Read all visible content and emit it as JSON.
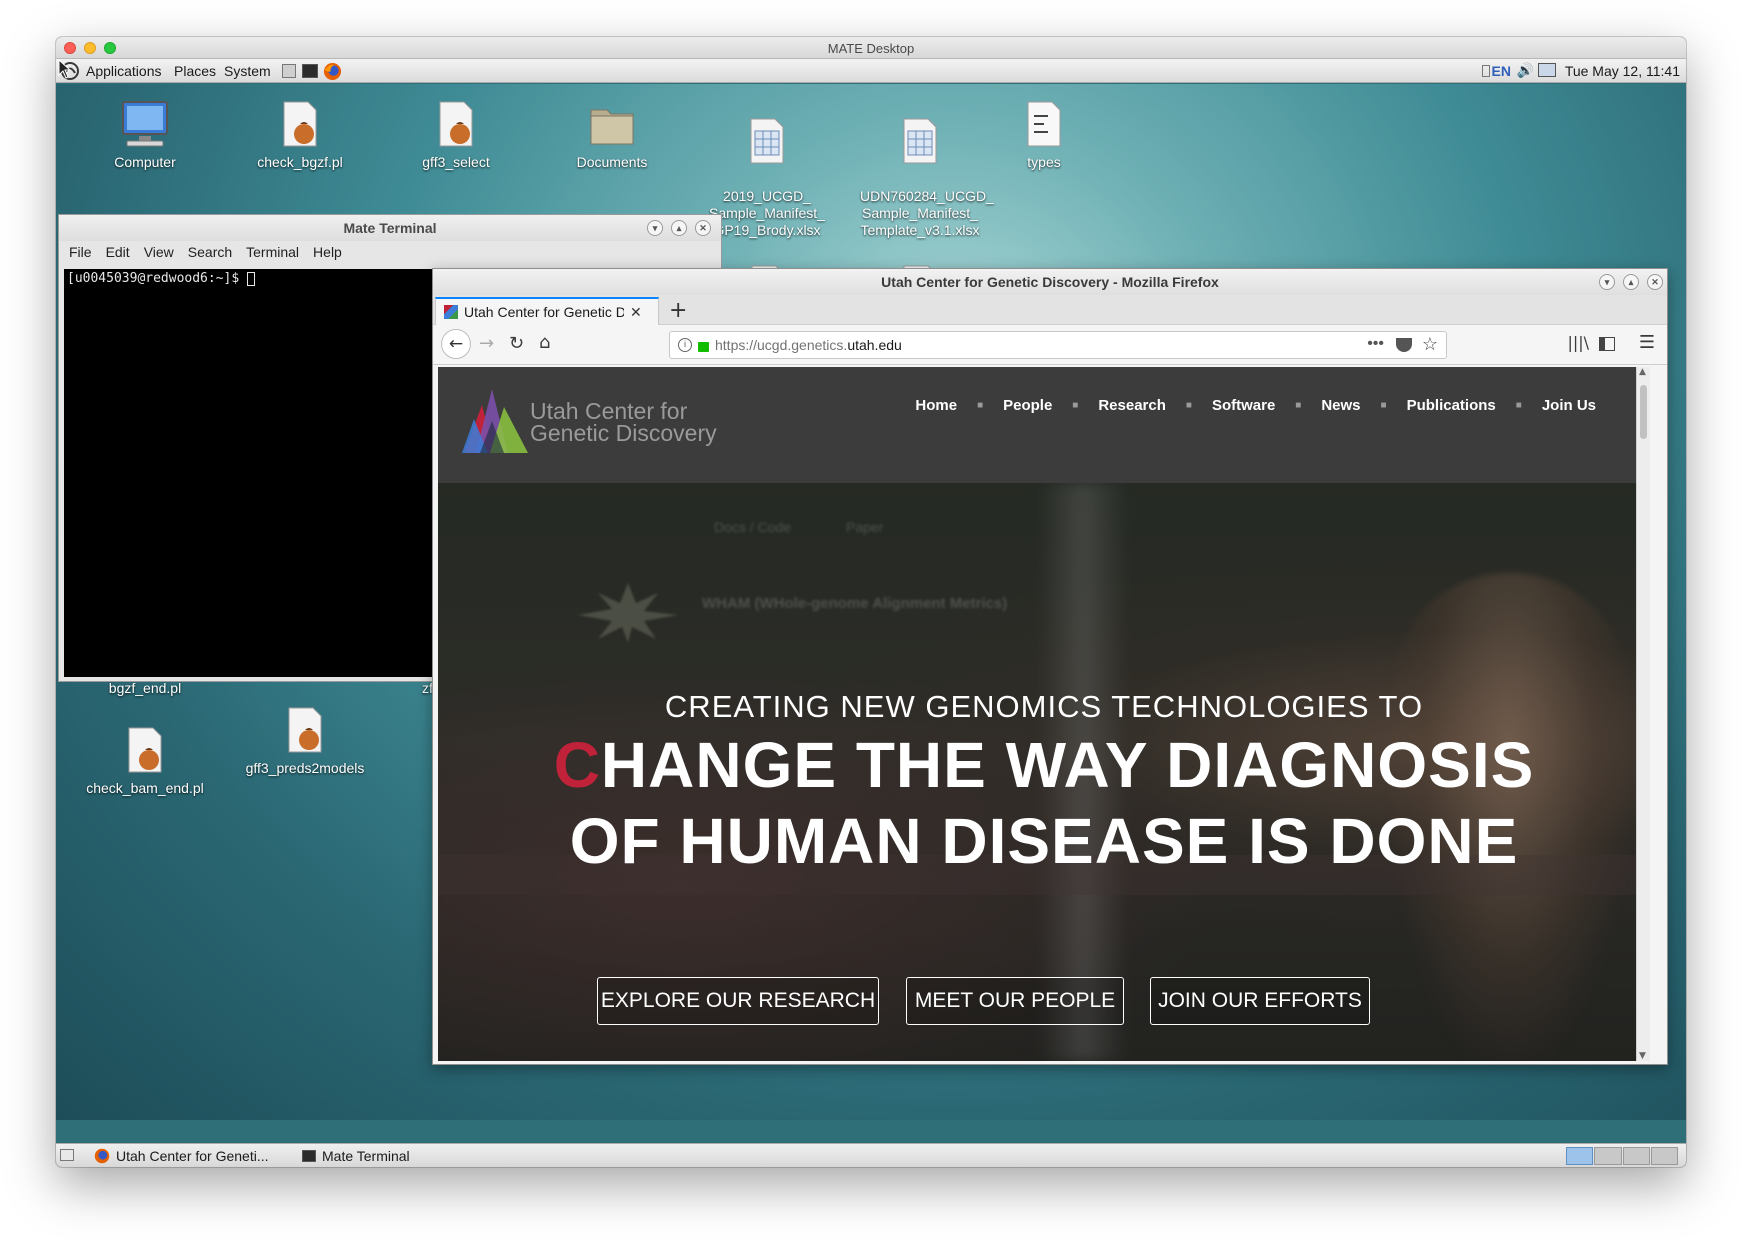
{
  "mac_window": {
    "title": "MATE Desktop"
  },
  "top_panel": {
    "menus": [
      "Applications",
      "Places",
      "System"
    ],
    "keyboard_layout": "EN",
    "clock": "Tue May 12, 11:41"
  },
  "desktop_icons": [
    {
      "label": "Computer"
    },
    {
      "label": "check_bgzf.pl"
    },
    {
      "label": "gff3_select"
    },
    {
      "label": "Documents"
    },
    {
      "label": "2019_UCGD_\nSample_Manifest_\nGP19_Brody.xlsx"
    },
    {
      "label": "UDN760284_UCGD_\nSample_Manifest_\nTemplate_v3.1.xlsx"
    },
    {
      "label": "types"
    },
    {
      "label": "bgzf_end.pl"
    },
    {
      "label": "zff2au"
    },
    {
      "label": "check_bam_end.pl"
    },
    {
      "label": "gff3_preds2models"
    }
  ],
  "terminal": {
    "title": "Mate Terminal",
    "menus": [
      "File",
      "Edit",
      "View",
      "Search",
      "Terminal",
      "Help"
    ],
    "prompt": "[u0045039@redwood6:~]$ "
  },
  "firefox": {
    "window_title": "Utah Center for Genetic Discovery - Mozilla Firefox",
    "tab_title": "Utah Center for Genetic D",
    "url_prefix": "https://ucgd.genetics.",
    "url_domain": "utah.edu",
    "url_suffix": ""
  },
  "site": {
    "logo_line1": "Utah Center for",
    "logo_line2": "Genetic Discovery",
    "nav": [
      "Home",
      "People",
      "Research",
      "Software",
      "News",
      "Publications",
      "Join Us"
    ],
    "hero_subtitle": "CREATING NEW GENOMICS TECHNOLOGIES TO",
    "hero_line1_first": "C",
    "hero_line1_rest": "HANGE THE WAY DIAGNOSIS",
    "hero_line2": "OF HUMAN DISEASE IS DONE",
    "buttons": [
      "EXPLORE OUR RESEARCH",
      "MEET OUR PEOPLE",
      "JOIN OUR EFFORTS"
    ],
    "bg_ghost": [
      "Docs / Code",
      "Paper",
      "WHAM (WHole-genome Alignment Metrics)"
    ]
  },
  "taskbar": {
    "items": [
      "Utah Center for Geneti...",
      "Mate Terminal"
    ]
  },
  "colors": {
    "accent_red": "#c0223a",
    "firefox_blue": "#0a84ff",
    "lock_green": "#12bc00"
  }
}
